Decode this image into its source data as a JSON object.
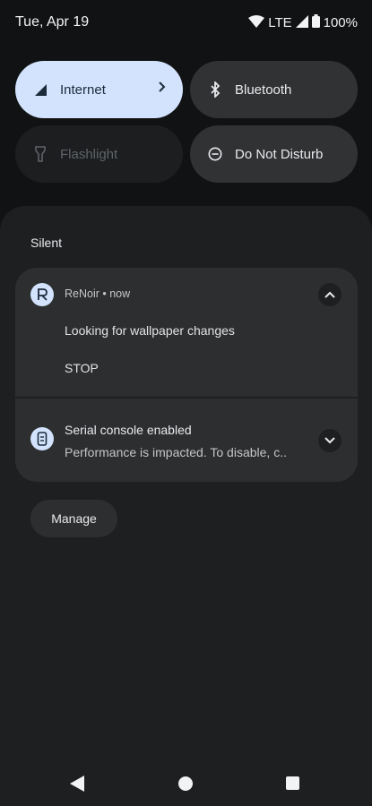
{
  "status_bar": {
    "date": "Tue, Apr 19",
    "network": "LTE",
    "battery": "100%"
  },
  "quick_settings": {
    "internet": "Internet",
    "bluetooth": "Bluetooth",
    "flashlight": "Flashlight",
    "dnd": "Do Not Disturb"
  },
  "section_label": "Silent",
  "notifications": [
    {
      "app": "ReNoir",
      "time": "now",
      "header": "ReNoir • now",
      "text": "Looking for wallpaper changes",
      "action": "STOP"
    },
    {
      "title": "Serial console enabled",
      "text": "Performance is impacted. To disable, c.."
    }
  ],
  "manage_label": "Manage",
  "colors": {
    "accent_tile": "#d3e3fd",
    "background": "#101213",
    "shade": "#1d1f21",
    "card": "#2c2e30"
  }
}
